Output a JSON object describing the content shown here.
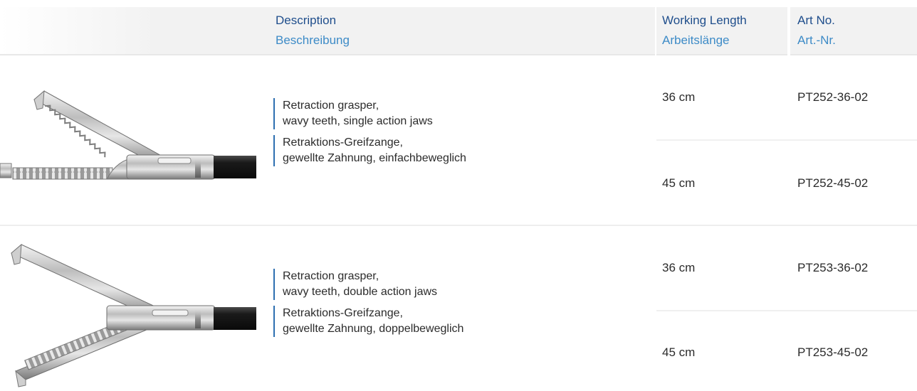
{
  "header": {
    "description_en": "Description",
    "description_de": "Beschreibung",
    "working_length_en": "Working Length",
    "working_length_de": "Arbeitslänge",
    "art_no_en": "Art No.",
    "art_no_de": "Art.-Nr."
  },
  "products": [
    {
      "image": "retraction-grasper-single-action-image",
      "desc_en": [
        "Retraction grasper,",
        "wavy teeth, single action jaws"
      ],
      "desc_de": [
        "Retraktions-Greifzange,",
        "gewellte Zahnung, einfachbeweglich"
      ],
      "variants": [
        {
          "length": "36 cm",
          "art_no": "PT252-36-02"
        },
        {
          "length": "45 cm",
          "art_no": "PT252-45-02"
        }
      ]
    },
    {
      "image": "retraction-grasper-double-action-image",
      "desc_en": [
        "Retraction grasper,",
        "wavy teeth, double action jaws"
      ],
      "desc_de": [
        "Retraktions-Greifzange,",
        "gewellte Zahnung, doppelbeweglich"
      ],
      "variants": [
        {
          "length": "36 cm",
          "art_no": "PT253-36-02"
        },
        {
          "length": "45 cm",
          "art_no": "PT253-45-02"
        }
      ]
    }
  ],
  "colors": {
    "header_en": "#1f4e8c",
    "header_de": "#3d8bc7",
    "accent_bar": "#2d6fb0",
    "header_bg": "#f2f2f2"
  }
}
